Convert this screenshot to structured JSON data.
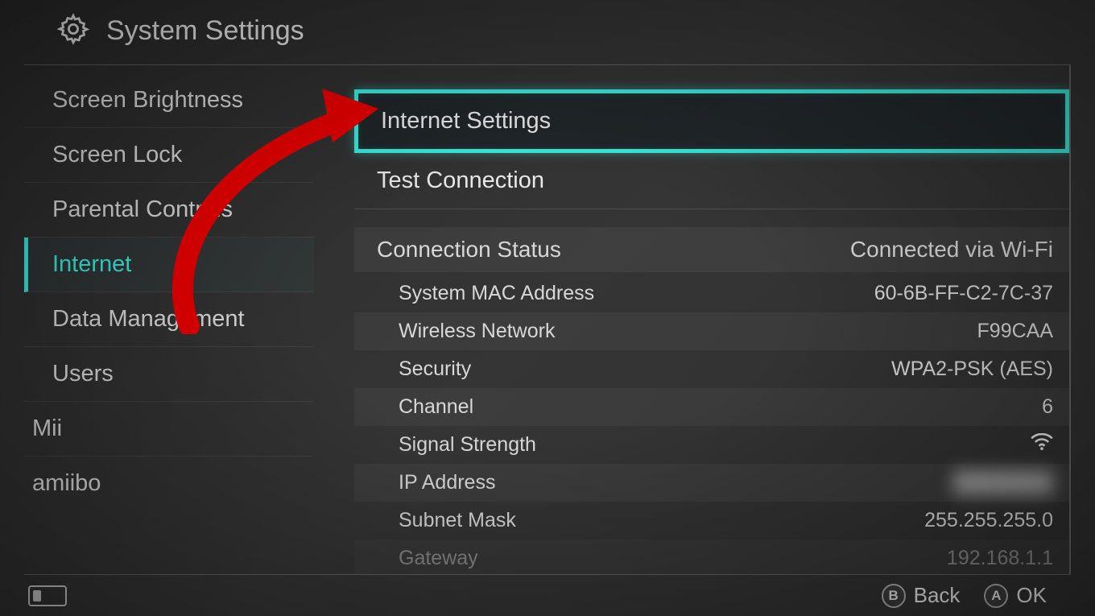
{
  "header": {
    "title": "System Settings"
  },
  "sidebar": {
    "items": [
      {
        "label": "Screen Brightness",
        "active": false
      },
      {
        "label": "Screen Lock",
        "active": false
      },
      {
        "label": "Parental Controls",
        "active": false
      },
      {
        "label": "Internet",
        "active": true
      },
      {
        "label": "Data Management",
        "active": false
      },
      {
        "label": "Users",
        "active": false
      },
      {
        "label": "Mii",
        "active": false
      },
      {
        "label": "amiibo",
        "active": false
      }
    ]
  },
  "main": {
    "selected_item": "Internet Settings",
    "items": [
      "Test Connection"
    ],
    "section": {
      "title": "Connection Status",
      "status": "Connected via Wi-Fi"
    },
    "details": [
      {
        "label": "System MAC Address",
        "value": "60-6B-FF-C2-7C-37",
        "icon": null
      },
      {
        "label": "Wireless Network",
        "value": "F99CAA",
        "icon": null
      },
      {
        "label": "Security",
        "value": "WPA2-PSK (AES)",
        "icon": null
      },
      {
        "label": "Channel",
        "value": "6",
        "icon": null
      },
      {
        "label": "Signal Strength",
        "value": "",
        "icon": "wifi"
      },
      {
        "label": "IP Address",
        "value": "",
        "blurred": true
      },
      {
        "label": "Subnet Mask",
        "value": "255.255.255.0",
        "icon": null
      },
      {
        "label": "Gateway",
        "value": "192.168.1.1",
        "icon": null
      }
    ]
  },
  "footer": {
    "back_label": "Back",
    "back_button": "B",
    "ok_label": "OK",
    "ok_button": "A"
  }
}
